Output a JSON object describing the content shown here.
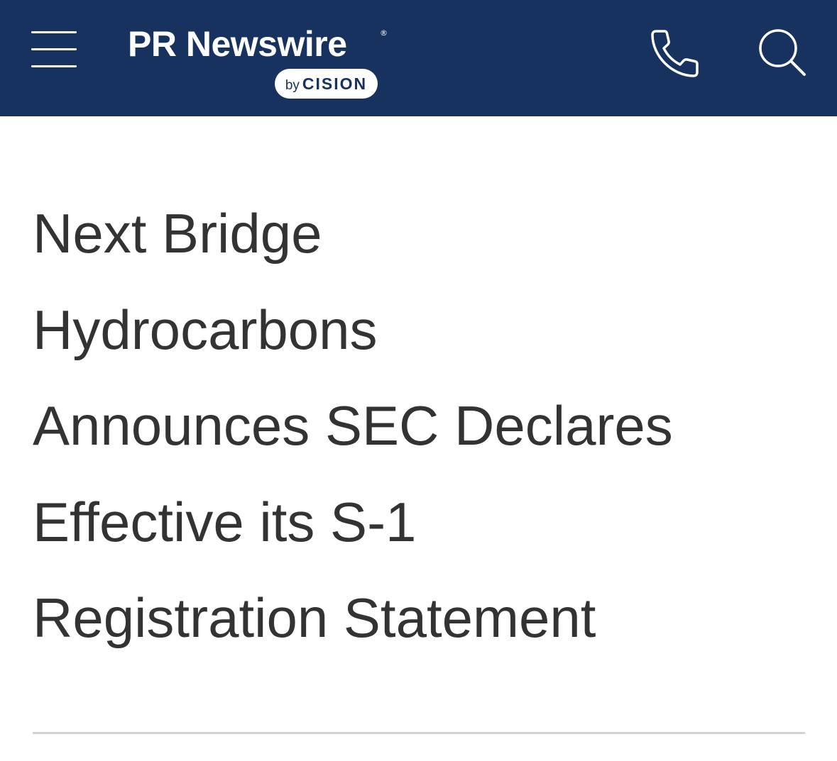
{
  "header": {
    "brand_name": "PR Newswire",
    "brand_mark": "®",
    "byline_prefix": "by",
    "byline_company": "CISION",
    "menu_icon": "menu-icon",
    "phone_icon": "phone-icon",
    "search_icon": "search-icon",
    "background_color": "#17325f"
  },
  "article": {
    "headline_lines": [
      "Next Bridge",
      "Hydrocarbons",
      "Announces SEC Declares",
      "Effective its S-1",
      "Registration Statement"
    ],
    "text_color": "#333333"
  }
}
